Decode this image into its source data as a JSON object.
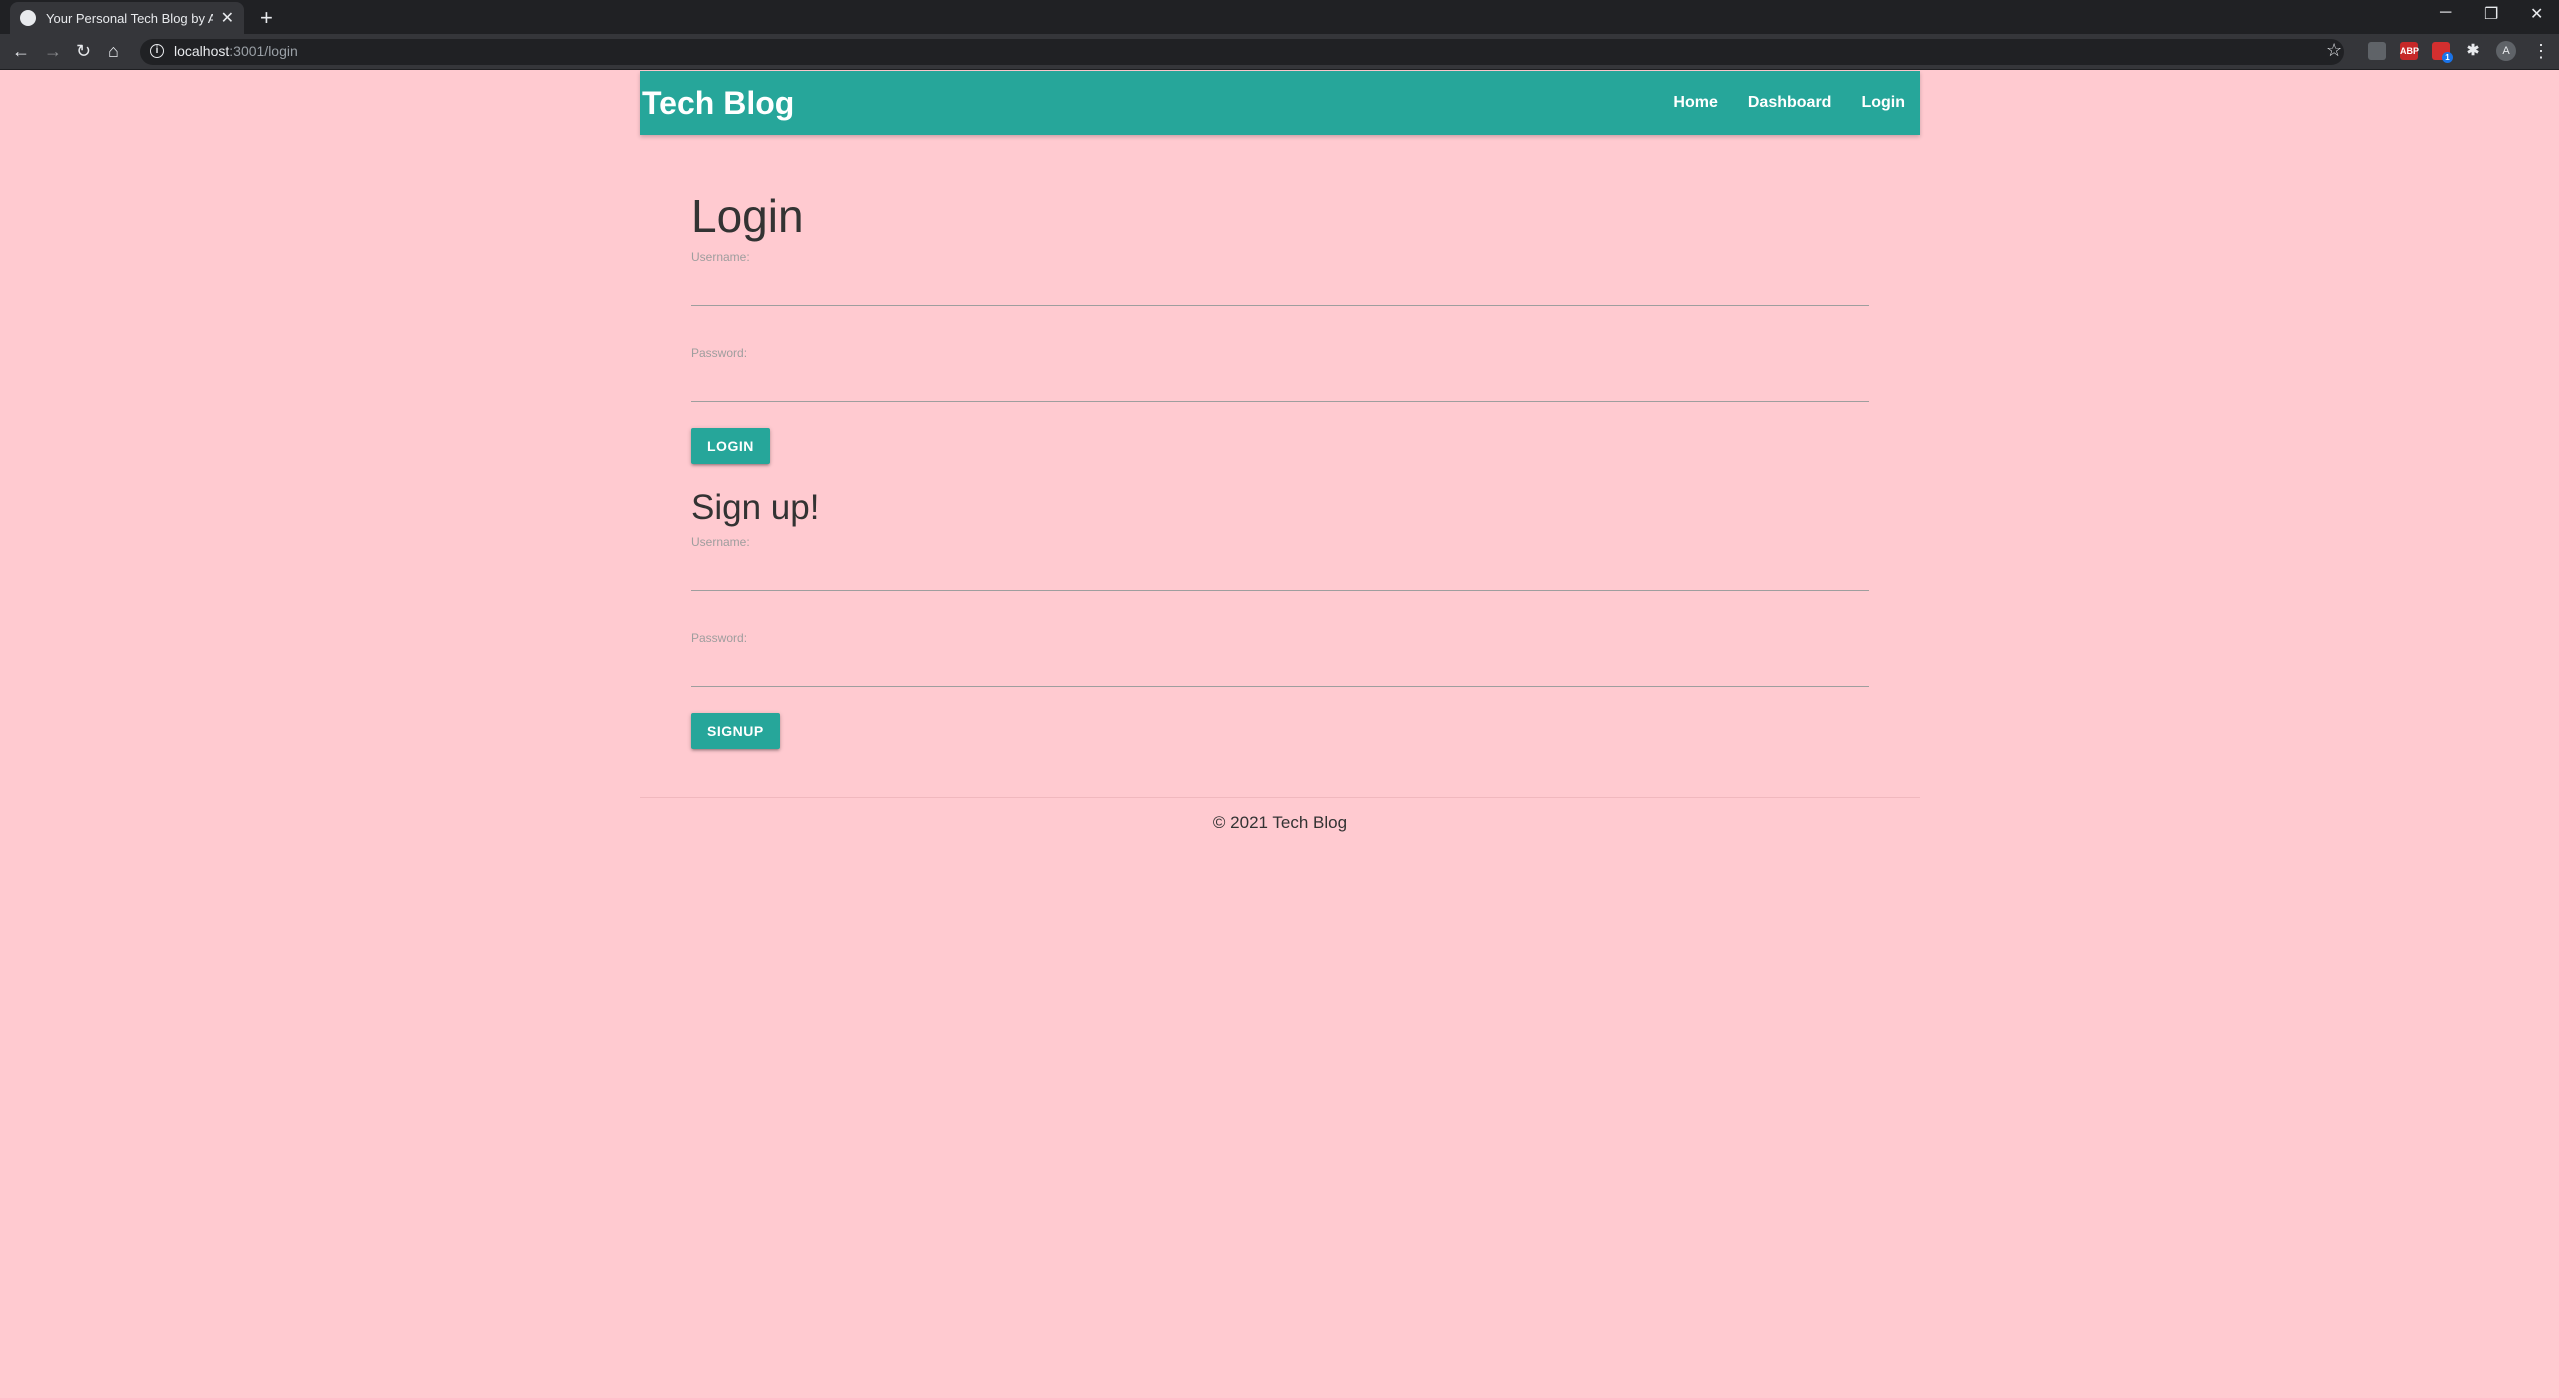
{
  "browser": {
    "tab_title": "Your Personal Tech Blog by Andr",
    "url_host": "localhost",
    "url_path": ":3001/login",
    "avatar_letter": "A",
    "abp_label": "ABP",
    "badge_count": "1"
  },
  "navbar": {
    "brand": "Tech Blog",
    "links": [
      "Home",
      "Dashboard",
      "Login"
    ]
  },
  "login": {
    "heading": "Login",
    "username_label": "Username:",
    "password_label": "Password:",
    "button": "LOGIN"
  },
  "signup": {
    "heading": "Sign up!",
    "username_label": "Username:",
    "password_label": "Password:",
    "button": "SIGNUP"
  },
  "footer": {
    "text": "© 2021 Tech Blog"
  },
  "colors": {
    "accent": "#26a69a",
    "background": "#ffcad0"
  }
}
